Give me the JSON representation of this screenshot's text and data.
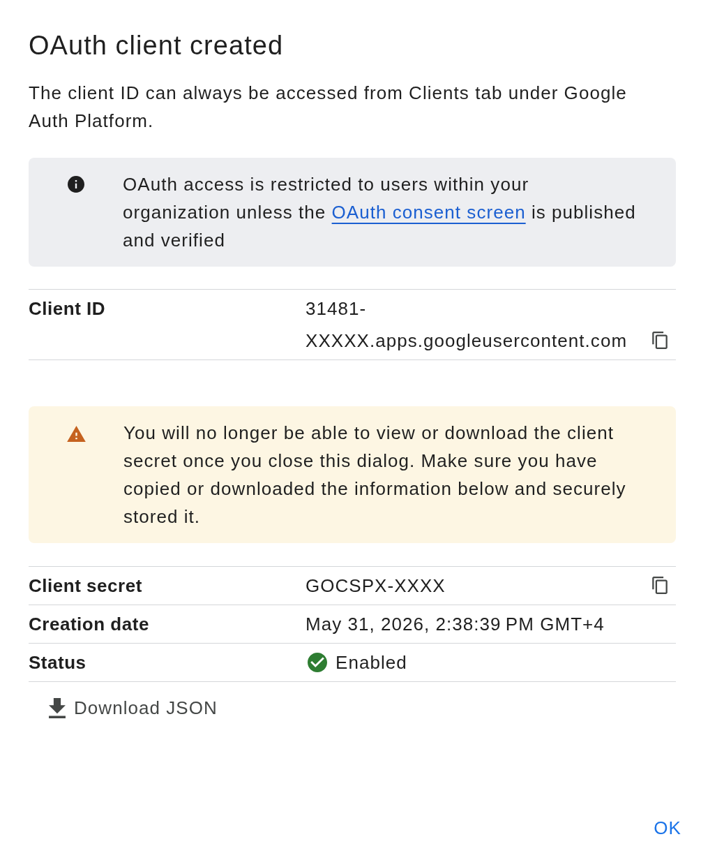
{
  "dialog": {
    "title": "OAuth client created",
    "description": "The client ID can always be accessed from Clients tab under Google Auth Platform."
  },
  "info_notice": {
    "kind": "info",
    "text_before": "OAuth access is restricted to users within your organization unless the ",
    "link": "OAuth consent screen",
    "text_after": " is published and verified"
  },
  "client_id_table": {
    "rows": [
      {
        "kind": "text",
        "label": "Client ID",
        "value": "31481-XXXXX.apps.googleusercontent.com",
        "copyable": true
      }
    ]
  },
  "warning_notice": {
    "kind": "warning",
    "text": "You will no longer be able to view or download the client secret once you close this dialog. Make sure you have copied or downloaded the information below and securely stored it."
  },
  "details_table": {
    "rows": [
      {
        "kind": "text",
        "label": "Client secret",
        "value": "GOCSPX-XXXX",
        "copyable": true
      },
      {
        "kind": "text",
        "label": "Creation date",
        "value": "May 31, 2026, 2:38:39 PM GMT+4",
        "copyable": false
      },
      {
        "kind": "status",
        "label": "Status",
        "value": "Enabled",
        "copyable": false,
        "enabled": true
      }
    ]
  },
  "download_button": {
    "label": "Download JSON"
  },
  "ok_button": {
    "label": "OK"
  }
}
